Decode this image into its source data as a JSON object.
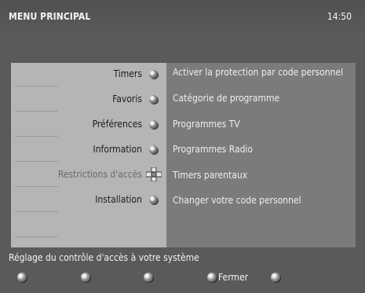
{
  "header": {
    "title": "MENU PRINCIPAL",
    "time": "14:50"
  },
  "menu": {
    "items": [
      {
        "label": "Timers",
        "state": "normal"
      },
      {
        "label": "Favoris",
        "state": "normal"
      },
      {
        "label": "Préférences",
        "state": "normal"
      },
      {
        "label": "Information",
        "state": "normal"
      },
      {
        "label": "Restrictions d'accès",
        "state": "selected"
      },
      {
        "label": "Installation",
        "state": "normal"
      }
    ]
  },
  "submenu": {
    "items": [
      {
        "label": "Activer la protection par code personnel"
      },
      {
        "label": "Catégorie de programme"
      },
      {
        "label": "Programmes TV"
      },
      {
        "label": "Programmes Radio"
      },
      {
        "label": "Timers parentaux"
      },
      {
        "label": "Changer votre code personnel"
      }
    ]
  },
  "footer": {
    "help_text": "Réglage du contrôle d'accès à votre système",
    "buttons": [
      {
        "label": ""
      },
      {
        "label": ""
      },
      {
        "label": ""
      },
      {
        "label": "Fermer"
      },
      {
        "label": ""
      }
    ]
  },
  "colors": {
    "background": "#5a5a5a",
    "menu_panel": "#b5b5b5",
    "submenu_panel": "#7b7b7b",
    "text_light": "#f2f2f2",
    "text_dark": "#1c1c1c"
  }
}
